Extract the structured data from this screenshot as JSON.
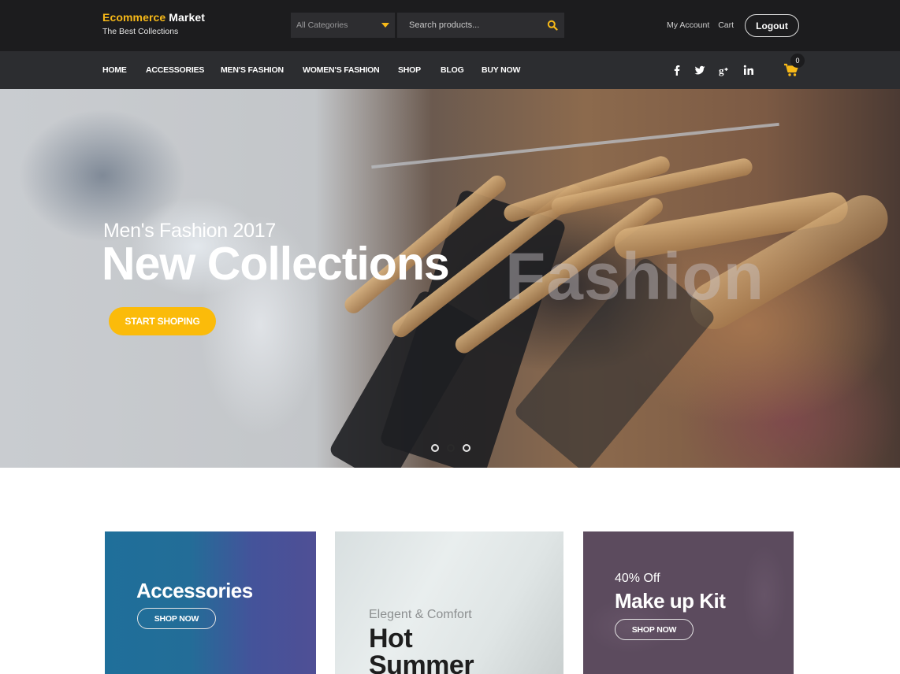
{
  "brand": {
    "title_accent": "Ecommerce",
    "title_rest": "Market",
    "tagline": "The Best Collections",
    "accent_color": "#f7b918"
  },
  "header": {
    "category_select": {
      "selected": "All Categories"
    },
    "search": {
      "placeholder": "Search products...",
      "icon": "search-icon"
    },
    "account_link": "My Account",
    "cart_link": "Cart",
    "logout_label": "Logout"
  },
  "nav": {
    "items": [
      {
        "label": "HOME"
      },
      {
        "label": "ACCESSORIES"
      },
      {
        "label": "MEN'S FASHION"
      },
      {
        "label": "WOMEN'S FASHION"
      },
      {
        "label": "SHOP"
      },
      {
        "label": "BLOG"
      },
      {
        "label": "BUY NOW"
      }
    ],
    "social": [
      {
        "name": "facebook-icon",
        "glyph": "f"
      },
      {
        "name": "twitter-icon",
        "glyph": "t"
      },
      {
        "name": "google-plus-icon",
        "glyph": "g+"
      },
      {
        "name": "linkedin-icon",
        "glyph": "in"
      }
    ],
    "cart_count": "0"
  },
  "hero": {
    "subtitle": "Men's Fashion 2017",
    "title": "New Collections",
    "watermark": "Fashion",
    "cta_label": "START SHOPING",
    "cta_color": "#fbbb0a",
    "slides_total": 3,
    "active_slide": 2
  },
  "promos": [
    {
      "title": "Accessories",
      "button": "SHOP NOW"
    },
    {
      "kicker": "Elegent & Comfort",
      "title_line1": "Hot",
      "title_line2": "Summer"
    },
    {
      "kicker": "40% Off",
      "title": "Make up Kit",
      "button": "SHOP NOW"
    }
  ]
}
